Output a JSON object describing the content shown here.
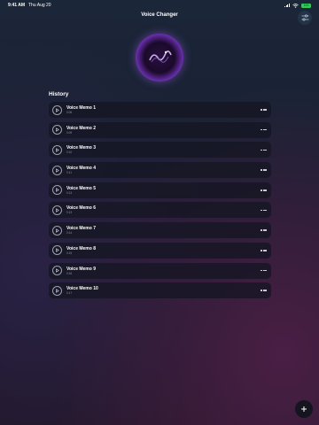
{
  "status_bar": {
    "time": "9:41 AM",
    "date": "Thu Aug 20",
    "battery": "100"
  },
  "nav": {
    "title": "Voice Changer",
    "settings_icon": "sliders-icon"
  },
  "history": {
    "title": "History",
    "items": [
      {
        "title": "Voice Memo 1",
        "duration": "0:06"
      },
      {
        "title": "Voice Memo 2",
        "duration": "0:09"
      },
      {
        "title": "Voice Memo 3",
        "duration": "0:10"
      },
      {
        "title": "Voice Memo 4",
        "duration": "0:11"
      },
      {
        "title": "Voice Memo 5",
        "duration": "0:13"
      },
      {
        "title": "Voice Memo 6",
        "duration": "0:13"
      },
      {
        "title": "Voice Memo 7",
        "duration": "0:14"
      },
      {
        "title": "Voice Memo 8",
        "duration": "0:15"
      },
      {
        "title": "Voice Memo 9",
        "duration": "0:16"
      },
      {
        "title": "Voice Memo 10",
        "duration": "0:17"
      }
    ]
  },
  "fab": {
    "icon": "plus-icon"
  },
  "colors": {
    "accent": "#9b5ae6",
    "battery": "#35c759"
  }
}
